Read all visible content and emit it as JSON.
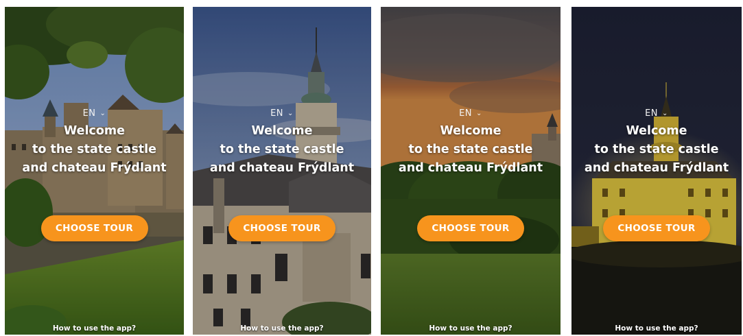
{
  "screens": [
    {
      "lang": "EN",
      "welcome": [
        "Welcome",
        "to the state castle",
        "and chateau Frýdlant"
      ],
      "button": "CHOOSE TOUR",
      "help": "How to use the app?"
    },
    {
      "lang": "EN",
      "welcome": [
        "Welcome",
        "to the state castle",
        "and chateau Frýdlant"
      ],
      "button": "CHOOSE TOUR",
      "help": "How to use the app?"
    },
    {
      "lang": "EN",
      "welcome": [
        "Welcome",
        "to the state castle",
        "and chateau Frýdlant"
      ],
      "button": "CHOOSE TOUR",
      "help": "How to use the app?"
    },
    {
      "lang": "EN",
      "welcome": [
        "Welcome",
        "to the state castle",
        "and chateau Frýdlant"
      ],
      "button": "CHOOSE TOUR",
      "help": "How to use the app?"
    }
  ],
  "colors": {
    "accent": "#f7941d",
    "text": "#ffffff"
  },
  "icons": {
    "language_dropdown": "chevron-down-icon"
  }
}
